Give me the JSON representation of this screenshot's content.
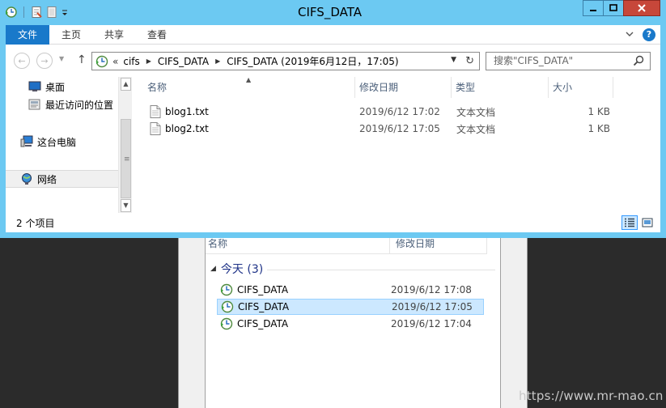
{
  "window": {
    "title": "CIFS_DATA",
    "controls": {
      "minimize": "minimize",
      "maximize": "maximize",
      "close": "close"
    }
  },
  "ribbon": {
    "tabs": [
      "文件",
      "主页",
      "共享",
      "查看"
    ],
    "help_label": "?"
  },
  "navigation": {
    "breadcrumb_prefix": "«",
    "breadcrumb": [
      "cifs",
      "CIFS_DATA",
      "CIFS_DATA (2019年6月12日，17:05)"
    ],
    "search_placeholder": "搜索\"CIFS_DATA\""
  },
  "sidebar": {
    "items": [
      {
        "label": "桌面",
        "icon": "desktop-icon"
      },
      {
        "label": "最近访问的位置",
        "icon": "recent-places-icon"
      },
      {
        "label": "这台电脑",
        "icon": "computer-icon"
      },
      {
        "label": "网络",
        "icon": "network-icon",
        "selected": true
      }
    ]
  },
  "file_list": {
    "columns": [
      "名称",
      "修改日期",
      "类型",
      "大小"
    ],
    "sort_indicator": "▲",
    "rows": [
      {
        "name": "blog1.txt",
        "modified": "2019/6/12 17:02",
        "type": "文本文档",
        "size": "1 KB"
      },
      {
        "name": "blog2.txt",
        "modified": "2019/6/12 17:05",
        "type": "文本文档",
        "size": "1 KB"
      }
    ]
  },
  "status": {
    "item_count": "2 个项目"
  },
  "previous_versions": {
    "columns": [
      "名称",
      "修改日期"
    ],
    "group_label": "今天 (3)",
    "rows": [
      {
        "name": "CIFS_DATA",
        "modified": "2019/6/12 17:08",
        "selected": false
      },
      {
        "name": "CIFS_DATA",
        "modified": "2019/6/12 17:05",
        "selected": true
      },
      {
        "name": "CIFS_DATA",
        "modified": "2019/6/12 17:04",
        "selected": false
      }
    ]
  },
  "watermark": "https://www.mr-mao.cn",
  "colors": {
    "title_bar": "#6cc9f2",
    "file_tab": "#1979ca",
    "selection": "#cce8ff",
    "close_button": "#c7473a"
  }
}
